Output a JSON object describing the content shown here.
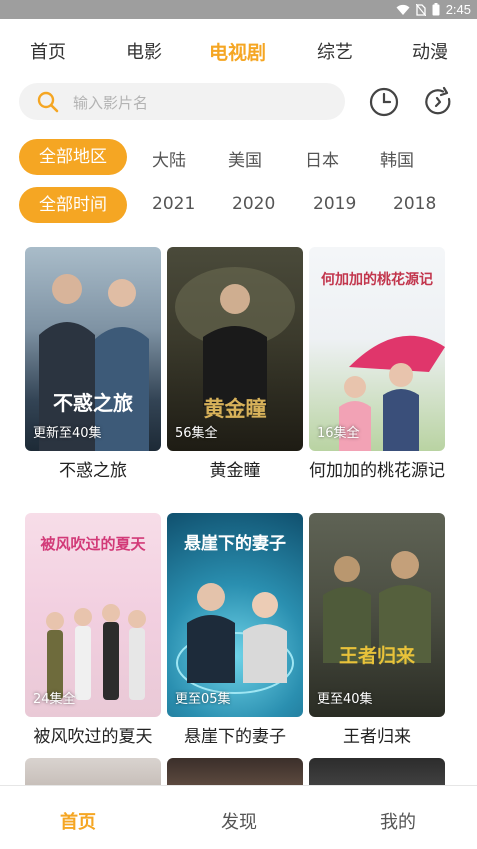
{
  "status": {
    "time": "2:45"
  },
  "nav": {
    "tabs": [
      {
        "label": "首页",
        "active": false
      },
      {
        "label": "电影",
        "active": false
      },
      {
        "label": "电视剧",
        "active": true
      },
      {
        "label": "综艺",
        "active": false
      },
      {
        "label": "动漫",
        "active": false
      }
    ]
  },
  "search": {
    "placeholder": "输入影片名"
  },
  "icons": {
    "search": "search-icon",
    "history": "clock-icon",
    "refresh": "refresh-icon"
  },
  "filters": {
    "region": {
      "selected": "全部地区",
      "options": [
        "大陆",
        "美国",
        "日本",
        "韩国"
      ]
    },
    "year": {
      "selected": "全部时间",
      "options": [
        "2021",
        "2020",
        "2019",
        "2018"
      ]
    }
  },
  "shows": [
    {
      "title": "不惑之旅",
      "badge": "更新至40集",
      "art_text": "不惑之旅"
    },
    {
      "title": "黄金瞳",
      "badge": "56集全",
      "art_text": "黄金瞳"
    },
    {
      "title": "何加加的桃花源记",
      "badge": "16集全",
      "art_text": "何加加的桃花源记"
    },
    {
      "title": "被风吹过的夏天",
      "badge": "24集全",
      "art_text": "被风吹过的夏天"
    },
    {
      "title": "悬崖下的妻子",
      "badge": "更至05集",
      "art_text": "悬崖下的妻子"
    },
    {
      "title": "王者归来",
      "badge": "更至40集",
      "art_text": "王者归来"
    }
  ],
  "bottom_nav": {
    "items": [
      {
        "label": "首页",
        "active": true
      },
      {
        "label": "发现",
        "active": false
      },
      {
        "label": "我的",
        "active": false
      }
    ]
  },
  "colors": {
    "accent": "#f5a623",
    "search_bg": "#f2f2f2",
    "statusbar": "#9e9e9e"
  }
}
